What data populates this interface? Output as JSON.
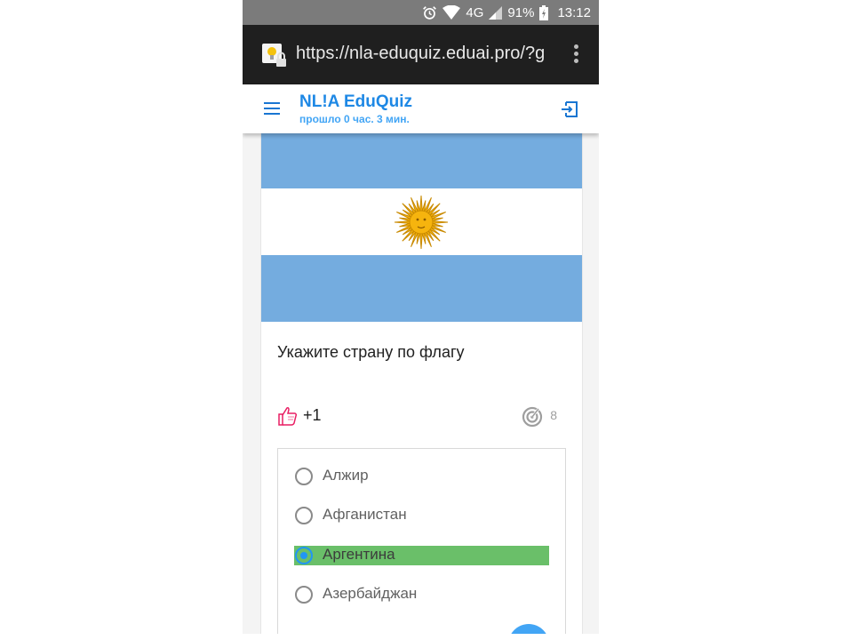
{
  "status_bar": {
    "network": "4G",
    "battery": "91%",
    "time": "13:12"
  },
  "browser": {
    "url": "https://nla-eduquiz.eduai.pro/?g"
  },
  "app": {
    "title": "NL!A EduQuiz",
    "subtitle": "прошло 0 час. 3 мин."
  },
  "question": {
    "image": "flag-of-argentina",
    "text": "Укажите страну по флагу",
    "score": "+1",
    "attempts": "8"
  },
  "options": [
    {
      "label": "Алжир",
      "selected": false,
      "correct": false
    },
    {
      "label": "Афганистан",
      "selected": false,
      "correct": false
    },
    {
      "label": "Аргентина",
      "selected": true,
      "correct": true
    },
    {
      "label": "Азербайджан",
      "selected": false,
      "correct": false
    }
  ],
  "colors": {
    "accent": "#1e88e5",
    "correct_highlight": "#6abf69",
    "flag_blue": "#74acdf",
    "sun": "#f6b40e"
  },
  "icons": {
    "status": [
      "alarm-icon",
      "wifi-icon",
      "signal-icon",
      "battery-icon"
    ],
    "header": [
      "menu-icon",
      "logout-icon"
    ],
    "score": [
      "thumbs-up-icon",
      "target-icon"
    ]
  }
}
